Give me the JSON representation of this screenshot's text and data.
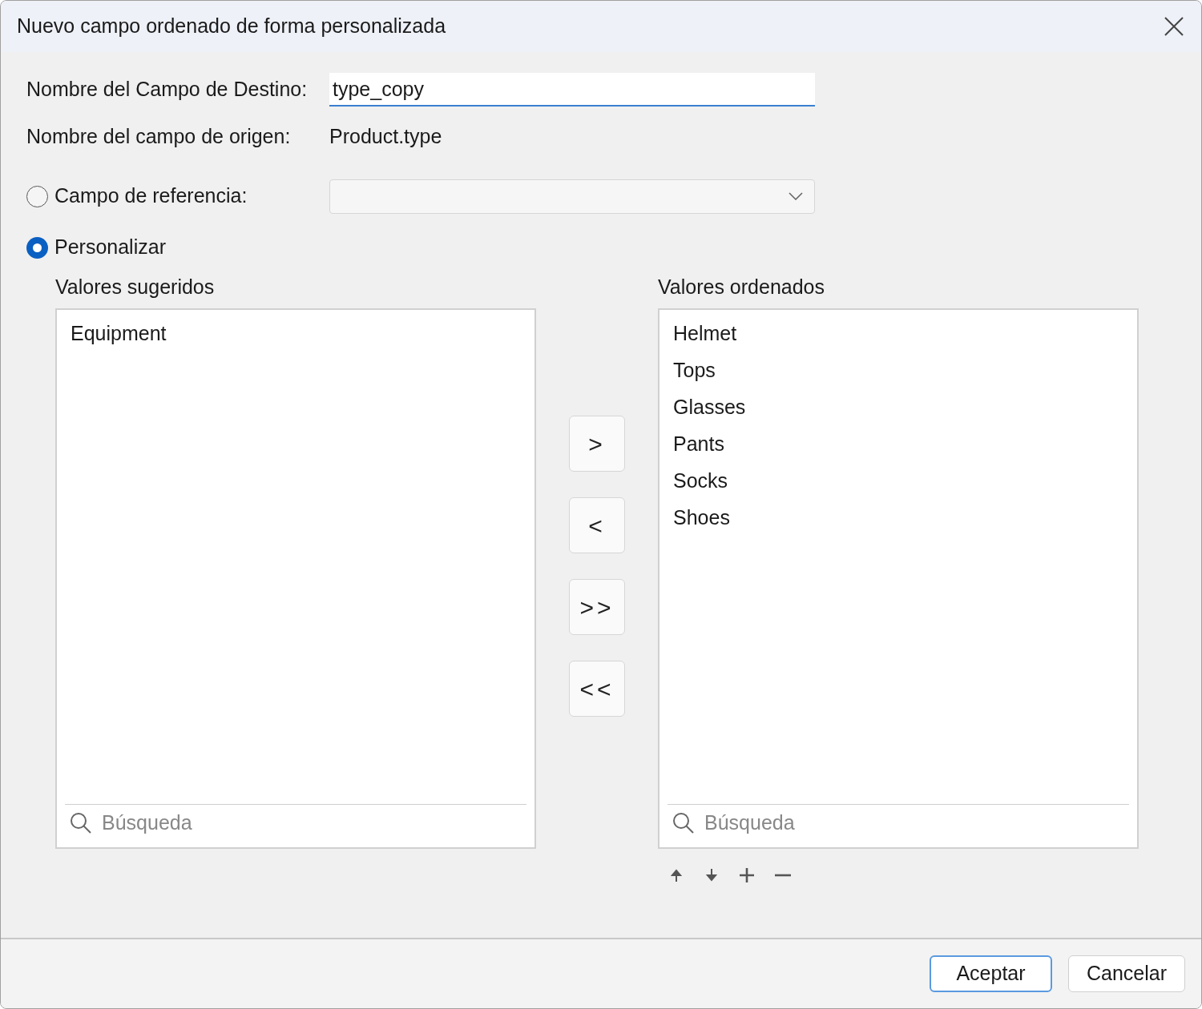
{
  "dialog": {
    "title": "Nuevo campo ordenado de forma personalizada"
  },
  "target_field": {
    "label": "Nombre del Campo de Destino:",
    "value": "type_copy"
  },
  "source_field": {
    "label": "Nombre del campo de origen:",
    "value": "Product.type"
  },
  "options": [
    {
      "label": "Campo de referencia:",
      "selected": false,
      "kind": "dropdown"
    },
    {
      "label": "Personalizar",
      "selected": true,
      "kind": "plain"
    }
  ],
  "suggested": {
    "heading": "Valores sugeridos",
    "items": [
      "Equipment"
    ],
    "search": {
      "placeholder": "Búsqueda"
    }
  },
  "transfer_buttons": [
    ">",
    "<",
    ">>",
    "<<"
  ],
  "ordered": {
    "heading": "Valores ordenados",
    "items": [
      "Helmet",
      "Tops",
      "Glasses",
      "Pants",
      "Socks",
      "Shoes"
    ],
    "search": {
      "placeholder": "Búsqueda"
    }
  },
  "list_tools": [
    {
      "kind": "up"
    },
    {
      "kind": "down"
    },
    {
      "kind": "add"
    },
    {
      "kind": "remove"
    }
  ],
  "buttons": [
    {
      "label": "Aceptar",
      "default": true
    },
    {
      "label": "Cancelar",
      "default": false
    }
  ]
}
